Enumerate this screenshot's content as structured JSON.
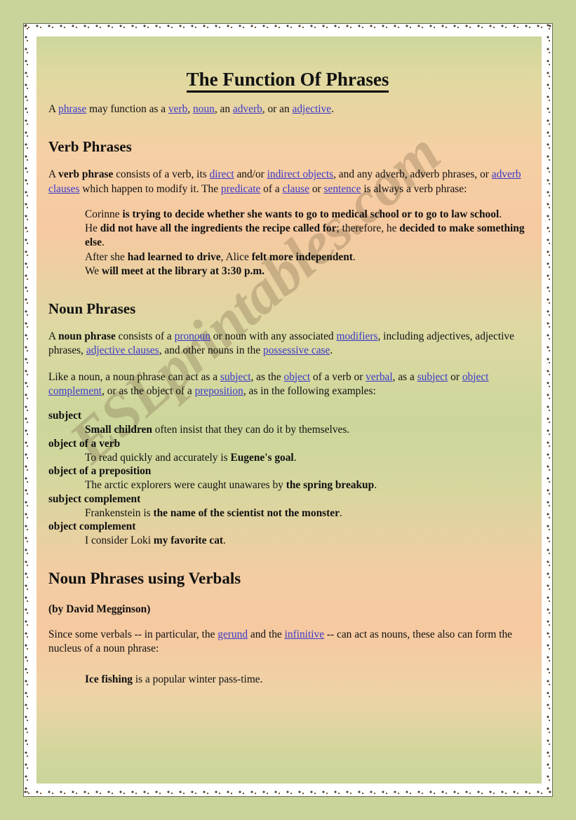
{
  "document": {
    "title": "The Function Of Phrases",
    "watermark": "ESLprintables.com",
    "link_color": "#3b38c9",
    "intro": {
      "t1": "A ",
      "l1": "phrase",
      "t2": " may function as a ",
      "l2": "verb",
      "t3": ", ",
      "l3": "noun",
      "t4": ", an ",
      "l4": "adverb",
      "t5": ", or an ",
      "l5": "adjective",
      "t6": "."
    },
    "verb_phrases": {
      "heading": "Verb Phrases",
      "para": {
        "t1": "A ",
        "b1": "verb phrase",
        "t2": " consists of a verb, its ",
        "l1": "direct",
        "t3": " and/or ",
        "l2": "indirect objects",
        "t4": ", and any adverb, adverb phrases, or ",
        "l3": "adverb clauses",
        "t5": " which happen to modify it. The ",
        "l4": "predicate",
        "t6": " of a ",
        "l5": "clause",
        "t7": " or ",
        "l6": "sentence",
        "t8": " is always a verb phrase:"
      },
      "examples": [
        {
          "pre": "Corinne ",
          "bold": "is trying to decide whether she wants to go to medical school or to go to law school",
          "post": "."
        },
        {
          "pre": "He ",
          "bold": "did not have all the ingredients the recipe called for",
          "mid": "; therefore, he ",
          "bold2": "decided to make something else",
          "post": "."
        },
        {
          "pre": "After she ",
          "bold": "had learned to drive",
          "mid": ", Alice ",
          "bold2": "felt more independent",
          "post": "."
        },
        {
          "pre": "We ",
          "bold": "will meet at the library at 3:30 p.m.",
          "post": ""
        }
      ]
    },
    "noun_phrases": {
      "heading": "Noun Phrases",
      "para1": {
        "t1": "A ",
        "b1": "noun phrase",
        "t2": " consists of a ",
        "l1": "pronoun",
        "t3": " or noun with any associated ",
        "l2": "modifiers",
        "t4": ", including adjectives, adjective phrases, ",
        "l3": "adjective clauses",
        "t5": ", and other nouns in the ",
        "l4": "possessive case",
        "t6": "."
      },
      "para2": {
        "t1": "Like a noun, a noun phrase can act as a ",
        "l1": "subject",
        "t2": ", as the ",
        "l2": "object",
        "t3": " of a verb or ",
        "l3": "verbal",
        "t4": ", as a ",
        "l4": "subject",
        "t5": " or ",
        "l5": "object complement",
        "t6": ", or as the object of a ",
        "l6": "preposition",
        "t7": ", as in the following examples:"
      },
      "definitions": [
        {
          "term": "subject",
          "pre": "",
          "bold": "Small children",
          "post": " often insist that they can do it by themselves."
        },
        {
          "term": "object of a verb",
          "pre": "To read quickly and accurately is ",
          "bold": "Eugene's goal",
          "post": "."
        },
        {
          "term": "object of a preposition",
          "pre": "The arctic explorers were caught unawares by ",
          "bold": "the spring breakup",
          "post": "."
        },
        {
          "term": "subject complement",
          "pre": "Frankenstein is ",
          "bold": "the name of the scientist not the monster",
          "post": "."
        },
        {
          "term": "object complement",
          "pre": "I consider Loki ",
          "bold": "my favorite cat",
          "post": "."
        }
      ]
    },
    "verbals": {
      "heading": "Noun Phrases using Verbals",
      "byline": "(by David Megginson)",
      "para": {
        "t1": "Since some verbals -- in particular, the ",
        "l1": "gerund",
        "t2": " and the ",
        "l2": "infinitive",
        "t3": " -- can act as nouns, these also can form the nucleus of a noun phrase:"
      },
      "example": {
        "bold": "Ice fishing",
        "post": " is a popular winter pass-time."
      }
    }
  }
}
